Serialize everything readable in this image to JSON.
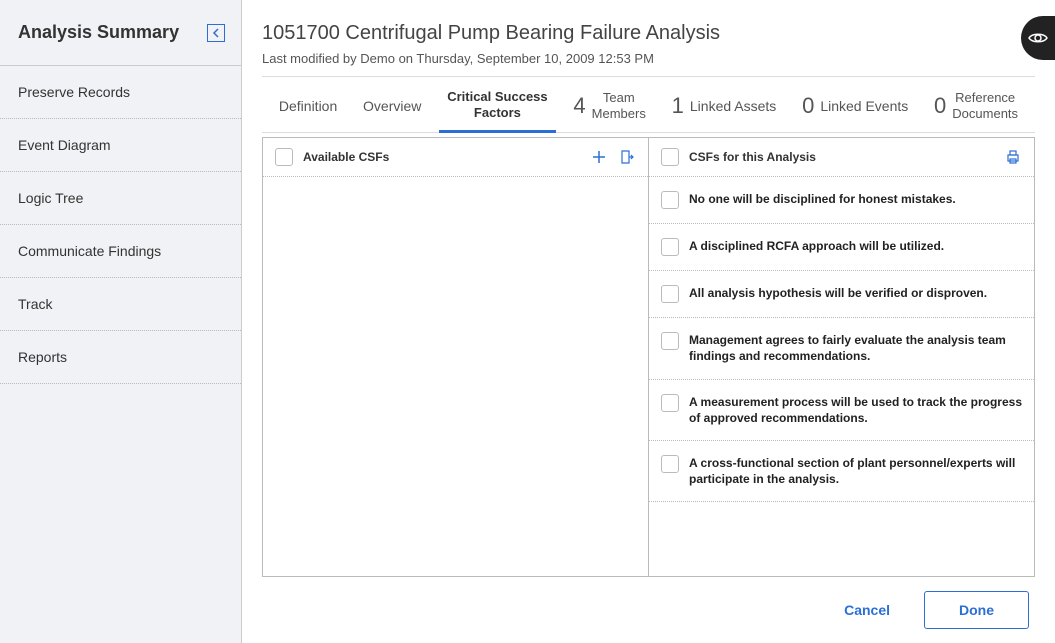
{
  "sidebar": {
    "title": "Analysis Summary",
    "items": [
      {
        "label": "Preserve Records"
      },
      {
        "label": "Event Diagram"
      },
      {
        "label": "Logic Tree"
      },
      {
        "label": "Communicate Findings"
      },
      {
        "label": "Track"
      },
      {
        "label": "Reports"
      }
    ]
  },
  "header": {
    "title": "1051700 Centrifugal Pump Bearing Failure Analysis",
    "subtitle": "Last modified by Demo on Thursday, September 10, 2009 12:53 PM"
  },
  "tabs": {
    "definition": "Definition",
    "overview": "Overview",
    "csf_line1": "Critical Success",
    "csf_line2": "Factors",
    "team_count": "4",
    "team_line1": "Team",
    "team_line2": "Members",
    "linked_assets_count": "1",
    "linked_assets_label": "Linked Assets",
    "linked_events_count": "0",
    "linked_events_label": "Linked Events",
    "refdocs_count": "0",
    "refdocs_line1": "Reference",
    "refdocs_line2": "Documents"
  },
  "left_pane": {
    "title": "Available CSFs"
  },
  "right_pane": {
    "title": "CSFs for this Analysis",
    "items": [
      "No one will be disciplined for honest mistakes.",
      "A disciplined RCFA approach will be utilized.",
      "All analysis hypothesis will be verified or disproven.",
      "Management agrees to fairly evaluate the analysis team findings and recommendations.",
      "A measurement process will be used to track the progress of approved recommendations.",
      "A cross-functional section of plant personnel/experts will participate in the analysis."
    ]
  },
  "footer": {
    "cancel": "Cancel",
    "done": "Done"
  }
}
